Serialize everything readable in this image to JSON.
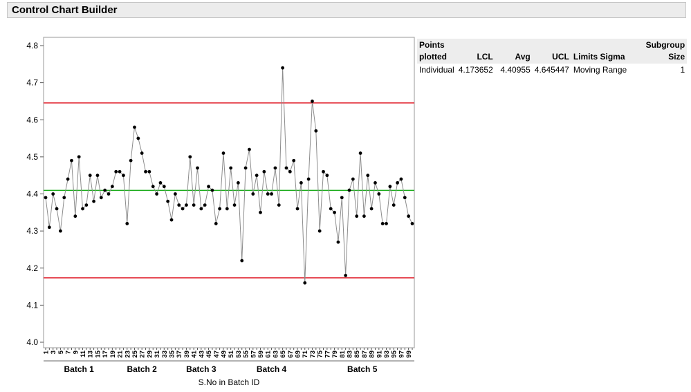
{
  "header": {
    "title": "Control Chart Builder"
  },
  "chart_data": {
    "type": "line",
    "title": "",
    "xlabel": "S.No in Batch ID",
    "ylabel": "",
    "ylim": [
      4.0,
      4.8
    ],
    "yticks": [
      "4.0",
      "4.1",
      "4.2",
      "4.3",
      "4.4",
      "4.5",
      "4.6",
      "4.7",
      "4.8"
    ],
    "grid": false,
    "x": [
      1,
      2,
      3,
      4,
      5,
      6,
      7,
      8,
      9,
      10,
      11,
      12,
      13,
      14,
      15,
      16,
      17,
      18,
      19,
      20,
      21,
      22,
      23,
      24,
      25,
      26,
      27,
      28,
      29,
      30,
      31,
      32,
      33,
      34,
      35,
      36,
      37,
      38,
      39,
      40,
      41,
      42,
      43,
      44,
      45,
      46,
      47,
      48,
      49,
      50,
      51,
      52,
      53,
      54,
      55,
      56,
      57,
      58,
      59,
      60,
      61,
      62,
      63,
      64,
      65,
      66,
      67,
      68,
      69,
      70,
      71,
      72,
      73,
      74,
      75,
      76,
      77,
      78,
      79,
      80,
      81,
      82,
      83,
      84,
      85,
      86,
      87,
      88,
      89,
      90,
      91,
      92,
      93,
      94,
      95,
      96,
      97,
      98,
      99,
      100
    ],
    "xtick_labels": [
      "1",
      "3",
      "5",
      "7",
      "9",
      "11",
      "13",
      "15",
      "17",
      "19",
      "21",
      "23",
      "25",
      "27",
      "29",
      "31",
      "33",
      "35",
      "37",
      "39",
      "41",
      "43",
      "45",
      "47",
      "49",
      "51",
      "53",
      "55",
      "57",
      "59",
      "61",
      "63",
      "65",
      "67",
      "69",
      "71",
      "73",
      "75",
      "77",
      "79",
      "81",
      "83",
      "85",
      "87",
      "89",
      "91",
      "93",
      "95",
      "97",
      "99"
    ],
    "batches": [
      {
        "label": "Batch 1",
        "start": 1,
        "end": 19
      },
      {
        "label": "Batch 2",
        "start": 20,
        "end": 34
      },
      {
        "label": "Batch 3",
        "start": 35,
        "end": 51
      },
      {
        "label": "Batch 4",
        "start": 52,
        "end": 72
      },
      {
        "label": "Batch 5",
        "start": 73,
        "end": 100
      }
    ],
    "series": [
      {
        "values": [
          4.39,
          4.31,
          4.4,
          4.36,
          4.3,
          4.39,
          4.44,
          4.49,
          4.34,
          4.5,
          4.36,
          4.37,
          4.45,
          4.38,
          4.45,
          4.39,
          4.41,
          4.4,
          4.42,
          4.46,
          4.46,
          4.45,
          4.32,
          4.49,
          4.58,
          4.55,
          4.51,
          4.46,
          4.46,
          4.42,
          4.4,
          4.43,
          4.42,
          4.38,
          4.33,
          4.4,
          4.37,
          4.36,
          4.37,
          4.5,
          4.37,
          4.47,
          4.36,
          4.37,
          4.42,
          4.41,
          4.32,
          4.36,
          4.51,
          4.36,
          4.47,
          4.37,
          4.43,
          4.22,
          4.47,
          4.52,
          4.4,
          4.45,
          4.35,
          4.46,
          4.4,
          4.4,
          4.47,
          4.37,
          4.74,
          4.47,
          4.46,
          4.49,
          4.36,
          4.43,
          4.16,
          4.44,
          4.65,
          4.57,
          4.3,
          4.46,
          4.45,
          4.36,
          4.35,
          4.27,
          4.39,
          4.18,
          4.41,
          4.44,
          4.34,
          4.51,
          4.34,
          4.45,
          4.36,
          4.43,
          4.4,
          4.32,
          4.32,
          4.42,
          4.37,
          4.43,
          4.44,
          4.39,
          4.34,
          4.32
        ]
      }
    ],
    "limits": {
      "ucl": 4.645447,
      "avg": 4.40955,
      "lcl": 4.173652
    },
    "colors": {
      "ucl": "#e0202c",
      "lcl": "#e0202c",
      "avg": "#1aab1a",
      "line": "#8c8c8c",
      "marker": "#000000"
    }
  },
  "table": {
    "headers": {
      "points_line1": "Points",
      "points_line2": "plotted",
      "lcl": "LCL",
      "avg": "Avg",
      "ucl": "UCL",
      "limits": "Limits Sigma",
      "subgroup_line1": "Subgroup",
      "subgroup_line2": "Size"
    },
    "row": {
      "points": "Individual",
      "lcl": "4.173652",
      "avg": "4.40955",
      "ucl": "4.645447",
      "limits": "Moving Range",
      "subgroup": "1"
    }
  }
}
